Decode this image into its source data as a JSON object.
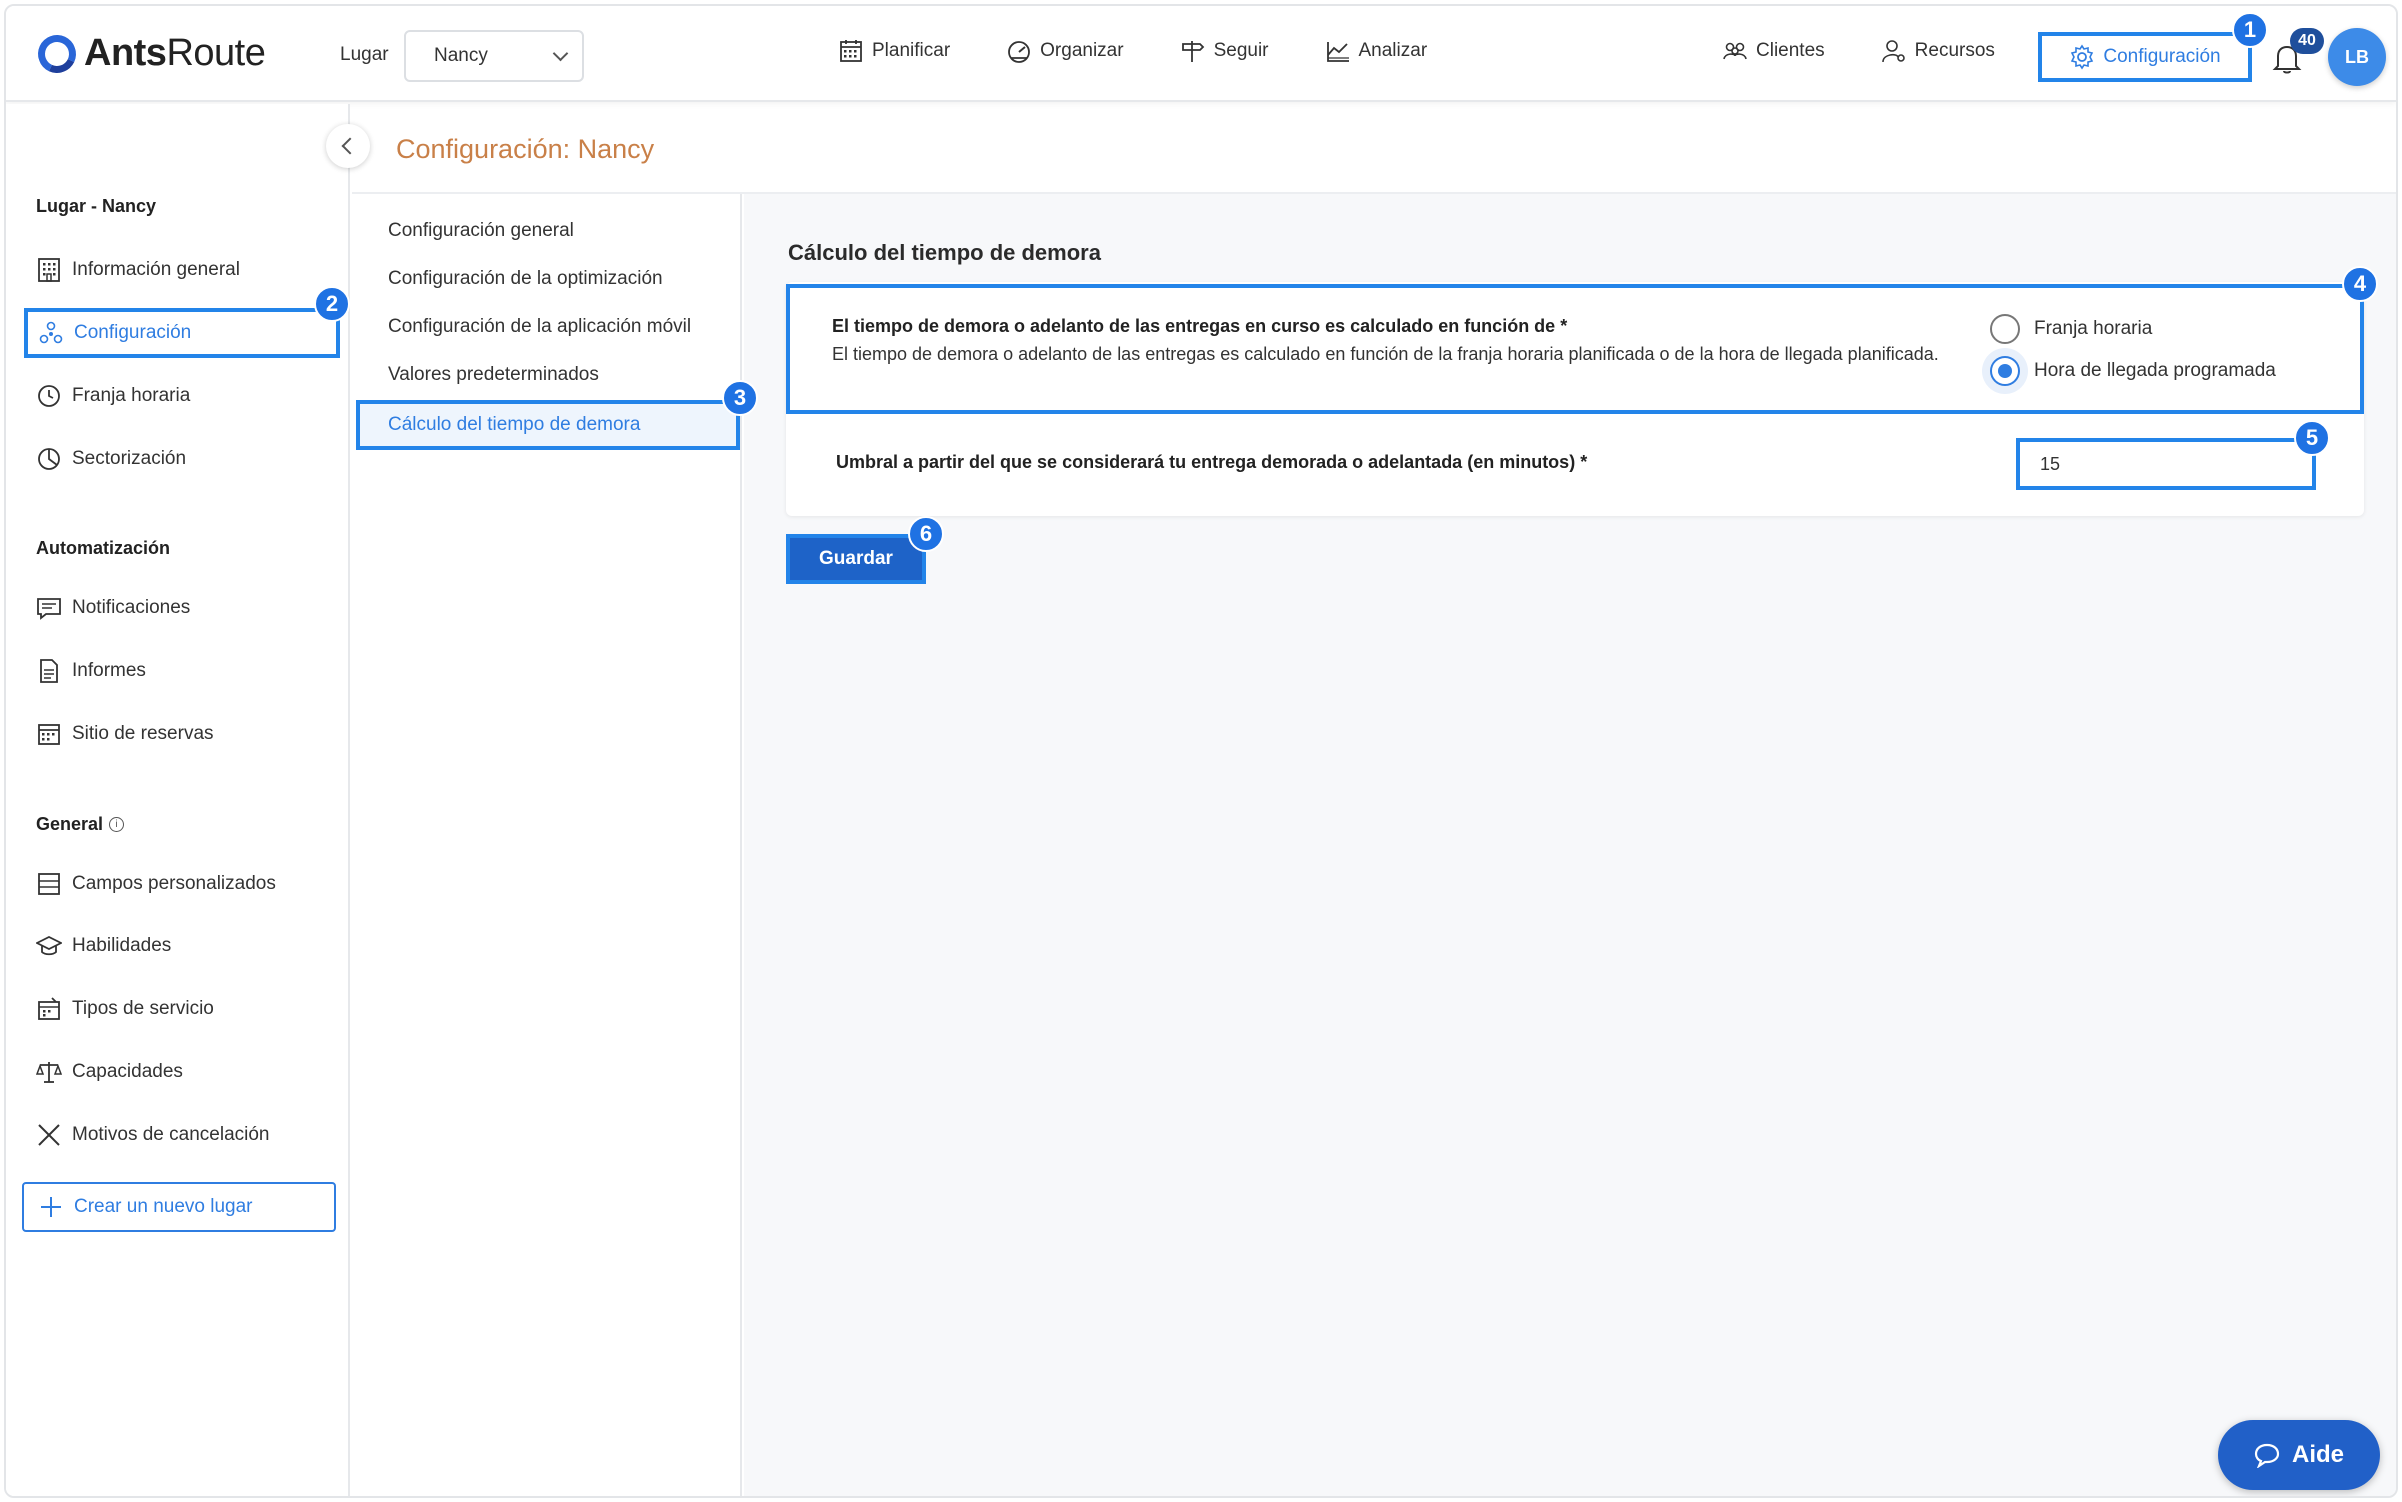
{
  "header": {
    "logo_text_bold": "Ants",
    "logo_text_rest": "Route",
    "lugar_label": "Lugar",
    "lugar_value": "Nancy",
    "nav": [
      {
        "label": "Planificar",
        "icon": "calendar-icon"
      },
      {
        "label": "Organizar",
        "icon": "gauge-icon"
      },
      {
        "label": "Seguir",
        "icon": "signpost-icon"
      },
      {
        "label": "Analizar",
        "icon": "chart-icon"
      }
    ],
    "nav_right": [
      {
        "label": "Clientes",
        "icon": "clients-icon"
      },
      {
        "label": "Recursos",
        "icon": "resources-icon"
      }
    ],
    "config_label": "Configuración",
    "notifications_count": "40",
    "avatar_initials": "LB"
  },
  "badges": [
    "1",
    "2",
    "3",
    "4",
    "5",
    "6"
  ],
  "sidebar": {
    "section_lugar": "Lugar - Nancy",
    "lugar_items": [
      {
        "label": "Información general",
        "icon": "building-icon"
      },
      {
        "label": "Configuración",
        "icon": "config-nodes-icon"
      },
      {
        "label": "Franja horaria",
        "icon": "clock-icon"
      },
      {
        "label": "Sectorización",
        "icon": "pie-icon"
      }
    ],
    "section_auto": "Automatización",
    "auto_items": [
      {
        "label": "Notificaciones",
        "icon": "message-icon"
      },
      {
        "label": "Informes",
        "icon": "document-icon"
      },
      {
        "label": "Sitio de reservas",
        "icon": "calendar-icon"
      }
    ],
    "section_general": "General",
    "general_items": [
      {
        "label": "Campos personalizados",
        "icon": "fields-icon"
      },
      {
        "label": "Habilidades",
        "icon": "graduation-cap-icon"
      },
      {
        "label": "Tipos de servicio",
        "icon": "service-icon"
      },
      {
        "label": "Capacidades",
        "icon": "scale-icon"
      },
      {
        "label": "Motivos de cancelación",
        "icon": "x-icon"
      }
    ],
    "new_place": "Crear un nuevo lugar"
  },
  "page_title": "Configuración: Nancy",
  "subnav": [
    "Configuración general",
    "Configuración de la optimización",
    "Configuración de la aplicación móvil",
    "Valores predeterminados",
    "Cálculo del tiempo de demora"
  ],
  "main": {
    "section_title": "Cálculo del tiempo de demora",
    "row1_title": "El tiempo de demora o adelanto de las entregas en curso es calculado en función de *",
    "row1_desc": "El tiempo de demora o adelanto de las entregas es calculado en función de la franja horaria planificada o de la hora de llegada planificada.",
    "radio_options": [
      "Franja horaria",
      "Hora de llegada programada"
    ],
    "radio_selected": "Hora de llegada programada",
    "row2_label": "Umbral a partir del que se considerará tu entrega demorada o adelantada (en minutos) *",
    "umbral_value": "15",
    "save_label": "Guardar"
  },
  "aide_label": "Aide",
  "colors": {
    "accent": "#2f7de1",
    "annotation": "#2384e9",
    "title_orange": "#c98048",
    "button": "#1e63c8"
  }
}
